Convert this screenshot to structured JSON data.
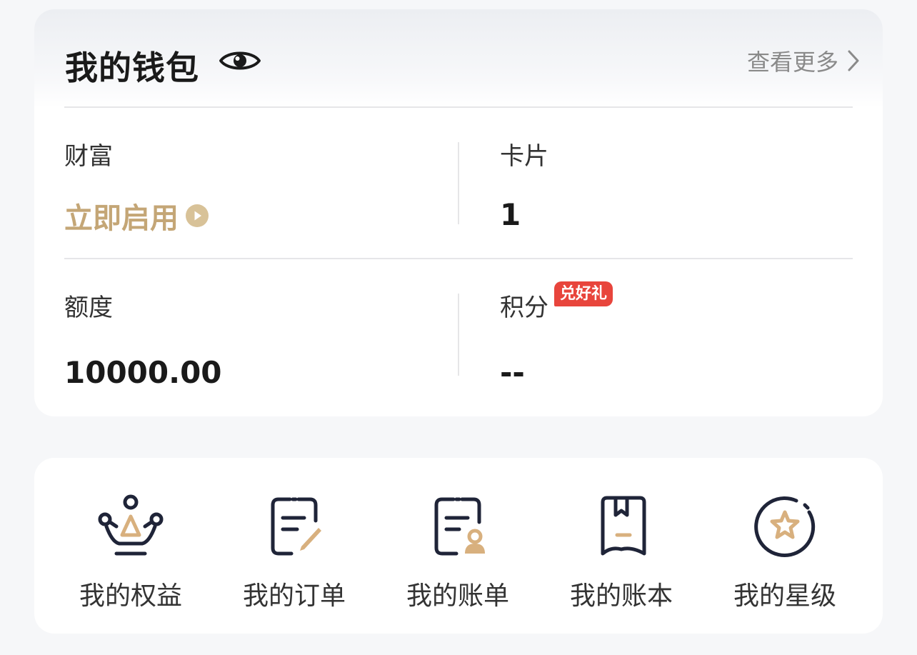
{
  "wallet": {
    "title": "我的钱包",
    "more_label": "查看更多",
    "wealth": {
      "label": "财富",
      "action": "立即启用"
    },
    "card": {
      "label": "卡片",
      "value": "1"
    },
    "quota": {
      "label": "额度",
      "value": "10000.00"
    },
    "points": {
      "label": "积分",
      "badge": "兑好礼",
      "value": "--"
    }
  },
  "shortcuts": [
    {
      "label": "我的权益",
      "icon": "crown-icon"
    },
    {
      "label": "我的订单",
      "icon": "order-edit-icon"
    },
    {
      "label": "我的账单",
      "icon": "bill-user-icon"
    },
    {
      "label": "我的账本",
      "icon": "ledger-bookmark-icon"
    },
    {
      "label": "我的星级",
      "icon": "star-level-icon"
    }
  ],
  "colors": {
    "gold": "#c4a676",
    "navy": "#1f2438",
    "badge_red": "#e8453c"
  }
}
